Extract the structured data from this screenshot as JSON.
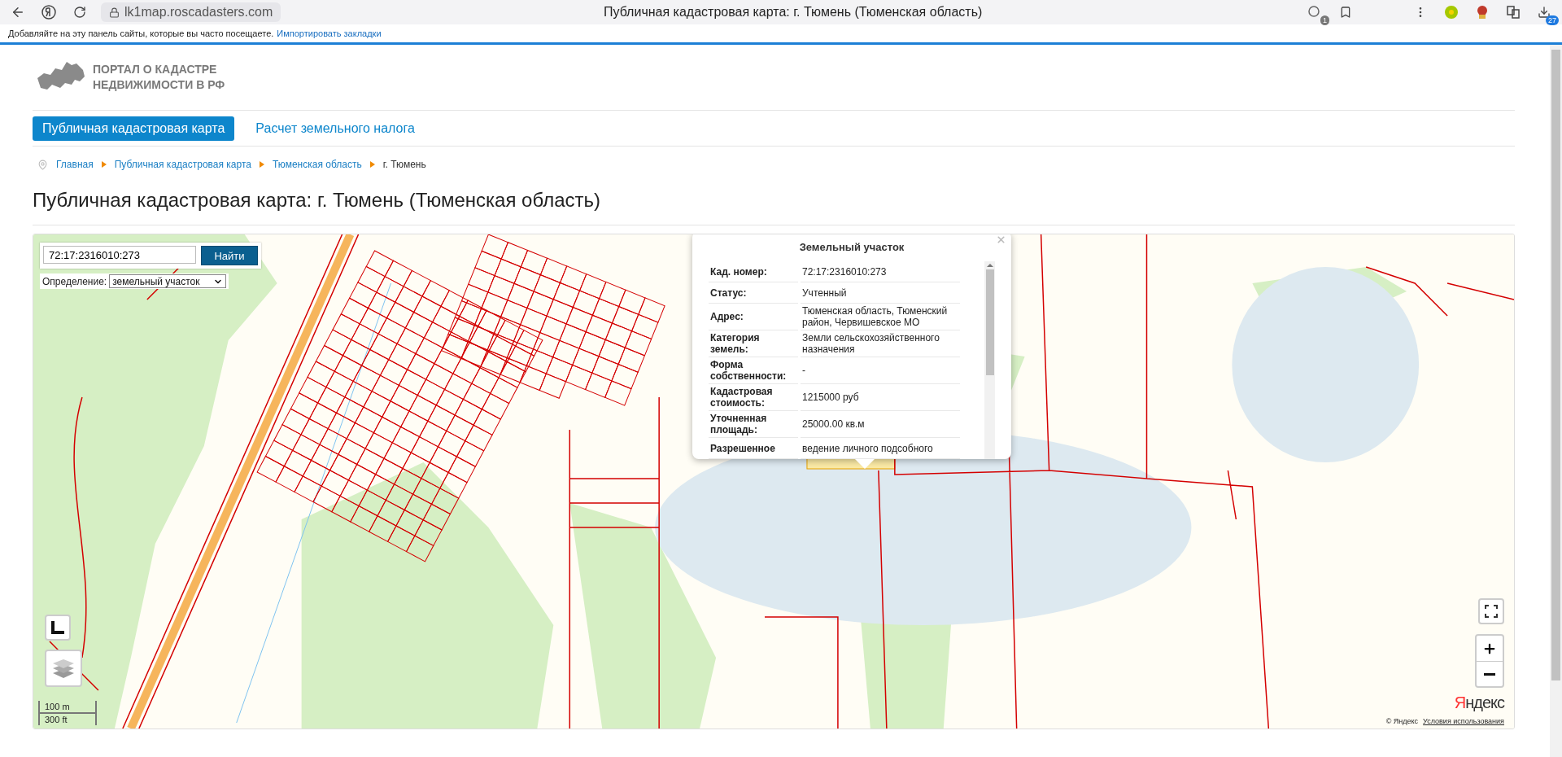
{
  "browser": {
    "url": "lk1map.roscadasters.com",
    "tab_title": "Публичная кадастровая карта: г. Тюмень (Тюменская область)",
    "reader_badge": "1",
    "downloads_badge": "27"
  },
  "bookmarks_bar": {
    "hint": "Добавляйте на эту панель сайты, которые вы часто посещаете.",
    "link": "Импортировать закладки"
  },
  "site": {
    "logo_lines": [
      "ПОРТАЛ О КАДАСТРЕ",
      "НЕДВИЖИМОСТИ В РФ"
    ]
  },
  "nav": [
    {
      "label": "Публичная кадастровая карта",
      "selected": true
    },
    {
      "label": "Расчет земельного налога",
      "selected": false
    }
  ],
  "breadcrumbs": [
    {
      "label": "Главная",
      "kind": "link"
    },
    {
      "label": "Публичная кадастровая карта",
      "kind": "link"
    },
    {
      "label": "Тюменская область",
      "kind": "link"
    },
    {
      "label": "г. Тюмень",
      "kind": "current"
    }
  ],
  "page_title": "Публичная кадастровая карта: г. Тюмень (Тюменская область)",
  "map": {
    "search": {
      "value": "72:17:2316010:273",
      "button": "Найти"
    },
    "definition": {
      "label": "Определение:",
      "value": "земельный участок"
    },
    "popup": {
      "title": "Земельный участок",
      "rows": [
        {
          "label": "Кад. номер:",
          "value": "72:17:2316010:273"
        },
        {
          "label": "Статус:",
          "value": "Учтенный"
        },
        {
          "label": "Адрес:",
          "value": "Тюменская область, Тюменский район, Червишевское МО"
        },
        {
          "label": "Категория земель:",
          "value": "Земли сельскохозяйственного назначения"
        },
        {
          "label": "Форма собственности:",
          "value": "-"
        },
        {
          "label": "Кадастровая стоимость:",
          "value": "1215000 руб"
        },
        {
          "label": "Уточненная площадь:",
          "value": "25000.00 кв.м"
        },
        {
          "label": "Разрешенное",
          "value": "ведение личного подсобного"
        }
      ]
    },
    "scale": [
      "100 m",
      "300 ft"
    ],
    "attribution": {
      "logo": "Яндекс",
      "copyright": "© Яндекс",
      "terms": "Условия использования"
    }
  }
}
